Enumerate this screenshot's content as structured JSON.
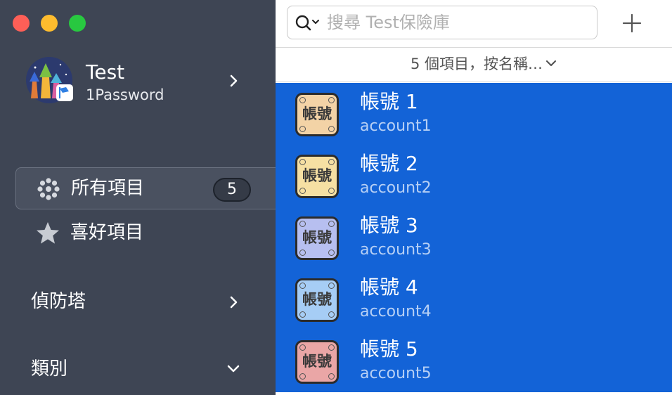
{
  "window": {
    "controls": [
      "close",
      "minimize",
      "maximize"
    ]
  },
  "sidebar": {
    "account": {
      "name": "Test",
      "subtitle": "1Password"
    },
    "nav": [
      {
        "label": "所有項目",
        "icon": "all-items-icon",
        "count": "5",
        "selected": true
      },
      {
        "label": "喜好項目",
        "icon": "star-icon"
      }
    ],
    "sections": [
      {
        "label": "偵防塔",
        "chevron": "right"
      },
      {
        "label": "類別",
        "chevron": "down"
      }
    ]
  },
  "toolbar": {
    "search_placeholder": "搜尋 Test保險庫",
    "add_icon": "plus-icon"
  },
  "list": {
    "sort_label": "5 個項目，按名稱…",
    "items": [
      {
        "title": "帳號 1",
        "subtitle": "account1",
        "icon_text": "帳號",
        "color": "#f3d3a6"
      },
      {
        "title": "帳號 2",
        "subtitle": "account2",
        "icon_text": "帳號",
        "color": "#f6e0a3"
      },
      {
        "title": "帳號 3",
        "subtitle": "account3",
        "icon_text": "帳號",
        "color": "#b7bff0"
      },
      {
        "title": "帳號 4",
        "subtitle": "account4",
        "icon_text": "帳號",
        "color": "#a6cdf5"
      },
      {
        "title": "帳號 5",
        "subtitle": "account5",
        "icon_text": "帳號",
        "color": "#eaa6a6"
      }
    ]
  },
  "colors": {
    "sidebar_bg": "#3e4554",
    "selection_blue": "#1363d7"
  }
}
